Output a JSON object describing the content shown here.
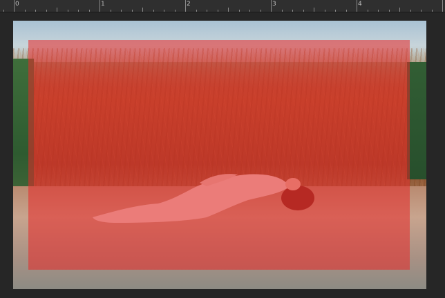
{
  "ruler": {
    "labels": [
      "0",
      "1",
      "2",
      "3",
      "4"
    ]
  },
  "canvas": {
    "mask_color": "#e82828",
    "mask_opacity": 0.55
  },
  "icons": {
    "photo": "photo-image"
  }
}
